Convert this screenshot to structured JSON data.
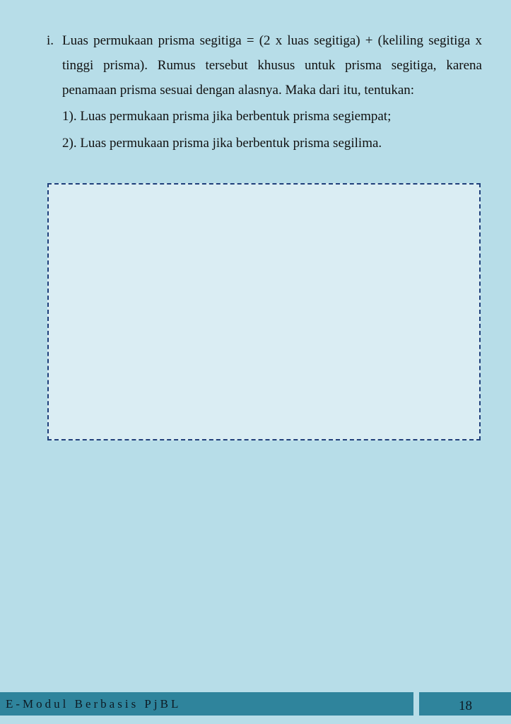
{
  "question": {
    "label": "i.",
    "text": "Luas permukaan prisma segitiga = (2 x luas segitiga) + (keliling segitiga x tinggi prisma). Rumus tersebut khusus untuk prisma segitiga, karena penamaan prisma sesuai dengan alasnya. Maka dari itu, tentukan:",
    "items": [
      "1). Luas permukaan prisma jika berbentuk prisma segiempat;",
      "2). Luas permukaan prisma jika berbentuk prisma segilima."
    ]
  },
  "footer": {
    "title": "E-Modul Berbasis PjBL",
    "page_number": "18"
  },
  "colors": {
    "page_background": "#b7dde8",
    "answer_box_fill": "#daedf3",
    "answer_box_border": "#1f3f7a",
    "footer_bar": "#2f849c"
  }
}
